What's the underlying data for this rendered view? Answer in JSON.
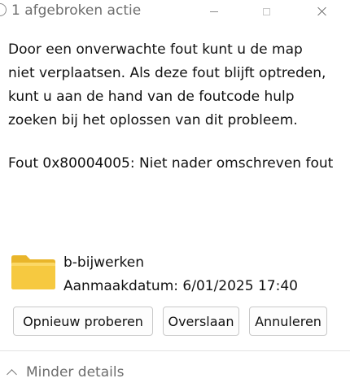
{
  "title": "1 afgebroken actie",
  "message": "Door een onverwachte fout kunt u de map\nniet verplaatsen. Als deze fout blijft optreden,\nkunt u aan de hand van de foutcode hulp\nzoeken bij het oplossen van dit probleem.",
  "error": "Fout 0x80004005: Niet nader omschreven fout",
  "item": {
    "icon": "folder-icon",
    "name": "b-bijwerken",
    "date": "Aanmaakdatum: 6/01/2025 17:40"
  },
  "buttons": {
    "retry": "Opnieuw proberen",
    "skip": "Overslaan",
    "cancel": "Annuleren"
  },
  "details_toggle": "Minder details",
  "colors": {
    "folder": "#f6c940",
    "folder_back": "#e9b52a"
  }
}
